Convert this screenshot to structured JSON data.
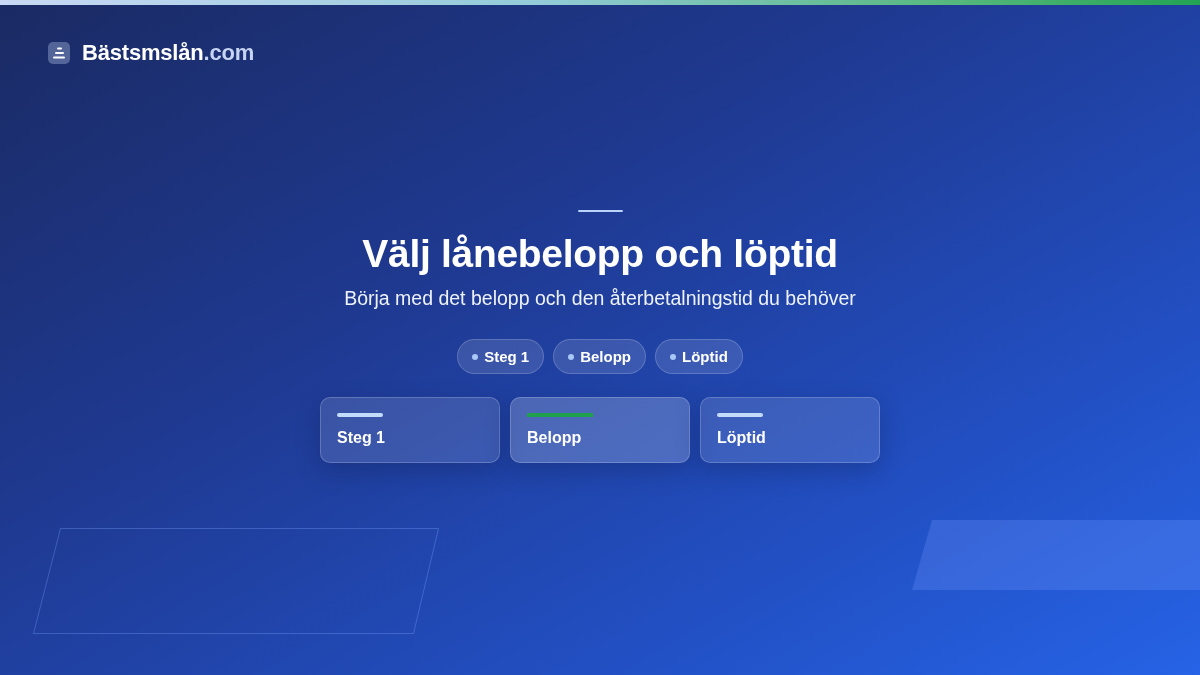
{
  "logo": {
    "name": "Bästsmslån",
    "suffix": ".com"
  },
  "hero": {
    "title": "Välj lånebelopp och löptid",
    "subtitle": "Börja med det belopp och den återbetalningstid du behöver"
  },
  "pills": [
    {
      "label": "Steg 1"
    },
    {
      "label": "Belopp"
    },
    {
      "label": "Löptid"
    }
  ],
  "steps": [
    {
      "label": "Steg 1",
      "selected": false
    },
    {
      "label": "Belopp",
      "selected": true
    },
    {
      "label": "Löptid",
      "selected": false
    }
  ]
}
